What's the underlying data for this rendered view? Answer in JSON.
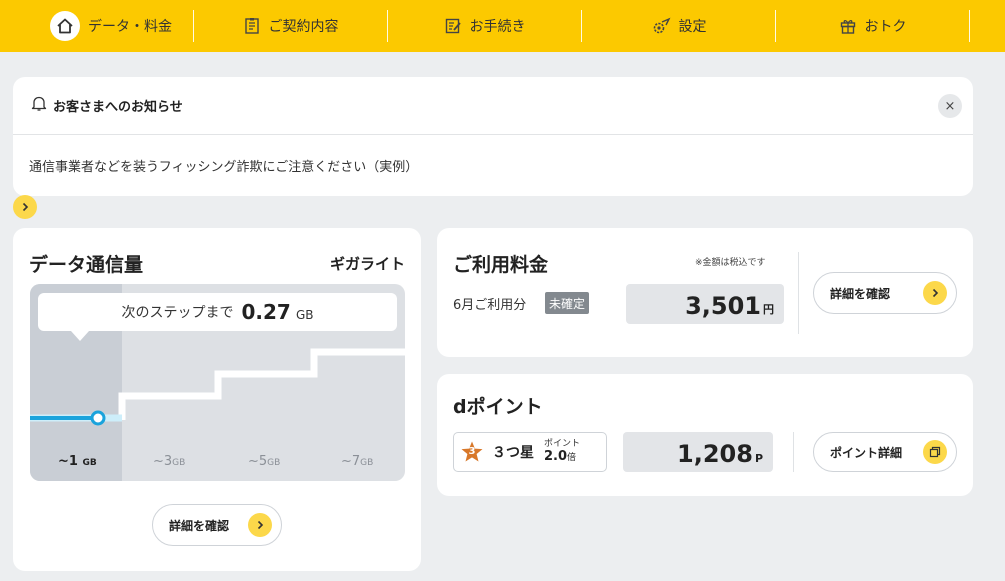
{
  "nav": {
    "items": [
      {
        "label": "データ・料金",
        "icon": "home-icon"
      },
      {
        "label": "ご契約内容",
        "icon": "contract-icon"
      },
      {
        "label": "お手続き",
        "icon": "procedure-icon"
      },
      {
        "label": "設定",
        "icon": "settings-icon"
      },
      {
        "label": "おトク",
        "icon": "gift-icon"
      }
    ],
    "accent": "#fcc900"
  },
  "notice": {
    "title": "お客さまへのお知らせ",
    "close": "×",
    "message": "通信事業者などを装うフィッシング詐欺にご注意ください（実例）"
  },
  "data_usage": {
    "title": "データ通信量",
    "plan": "ギガライト",
    "tooltip_label": "次のステップまで",
    "tooltip_value": "0.27",
    "tooltip_unit": "GB",
    "ticks": [
      {
        "num": "~1",
        "unit": "GB"
      },
      {
        "num": "~3",
        "unit": "GB"
      },
      {
        "num": "~5",
        "unit": "GB"
      },
      {
        "num": "~7",
        "unit": "GB"
      }
    ],
    "current_step": 1,
    "details_button": "詳細を確認"
  },
  "fee": {
    "title": "ご利用料金",
    "note": "※金額は税込です",
    "month": "6月ご利用分",
    "status": "未確定",
    "amount": "3,501",
    "currency": "円",
    "details_button": "詳細を確認"
  },
  "dpoint": {
    "title": "dポイント",
    "rank_number": "3",
    "rank_label": "３つ星",
    "multiplier_label": "ポイント",
    "multiplier_value": "2.0",
    "multiplier_unit": "倍",
    "points": "1,208",
    "points_unit": "P",
    "details_button": "ポイント詳細"
  }
}
